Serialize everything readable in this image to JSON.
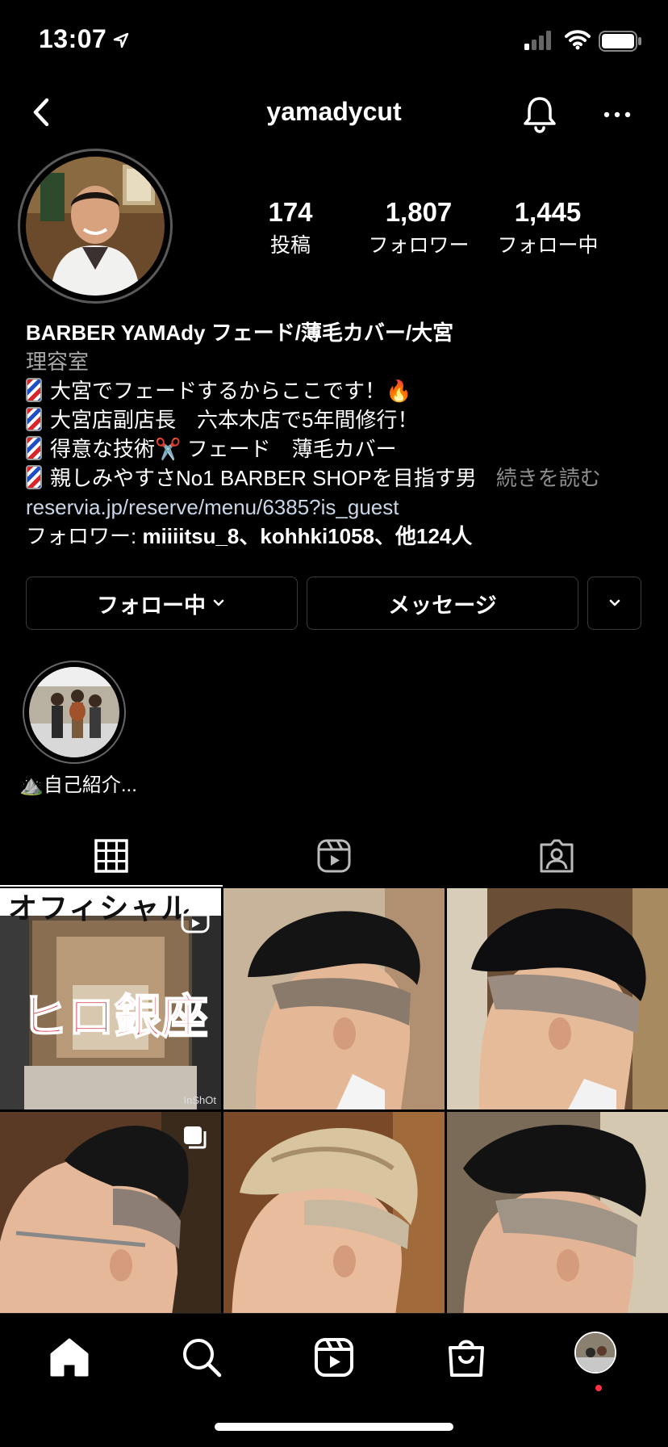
{
  "status_bar": {
    "time": "13:07"
  },
  "header": {
    "username": "yamadycut"
  },
  "stats": [
    {
      "value": "174",
      "label": "投稿"
    },
    {
      "value": "1,807",
      "label": "フォロワー"
    },
    {
      "value": "1,445",
      "label": "フォロー中"
    }
  ],
  "bio": {
    "name": "BARBER YAMAdy フェード/薄毛カバー/大宮",
    "category": "理容室",
    "lines": [
      "大宮でフェードするからここです！🔥",
      "大宮店副店長　六本木店で5年間修行！",
      "得意な技術✂️ フェード　薄毛カバー",
      "親しみやすさNo1 BARBER SHOPを目指す男"
    ],
    "more_label": "続きを読む",
    "link": "reservia.jp/reserve/menu/6385?is_guest",
    "followed_by_prefix": "フォロワー: ",
    "followed_by_names": "miiiitsu_8、kohhki1058、他124人"
  },
  "buttons": {
    "following": "フォロー中",
    "message": "メッセージ"
  },
  "highlights": [
    {
      "label": "自己紹介...",
      "emoji": "⛰️"
    }
  ],
  "grid": {
    "posts": [
      {
        "overlay_title": "オフィシャル",
        "overlay_main": "ヒロ銀座",
        "watermark": "InShOt",
        "type": "reel"
      },
      {
        "type": "photo"
      },
      {
        "type": "photo"
      },
      {
        "type": "carousel"
      },
      {
        "type": "photo"
      },
      {
        "type": "photo"
      }
    ]
  },
  "colors": {
    "background": "#000000",
    "link": "#c9d6e8",
    "secondary_text": "#a8a8a8",
    "button_border": "#3a3a3a",
    "notification_dot": "#ff3040"
  }
}
